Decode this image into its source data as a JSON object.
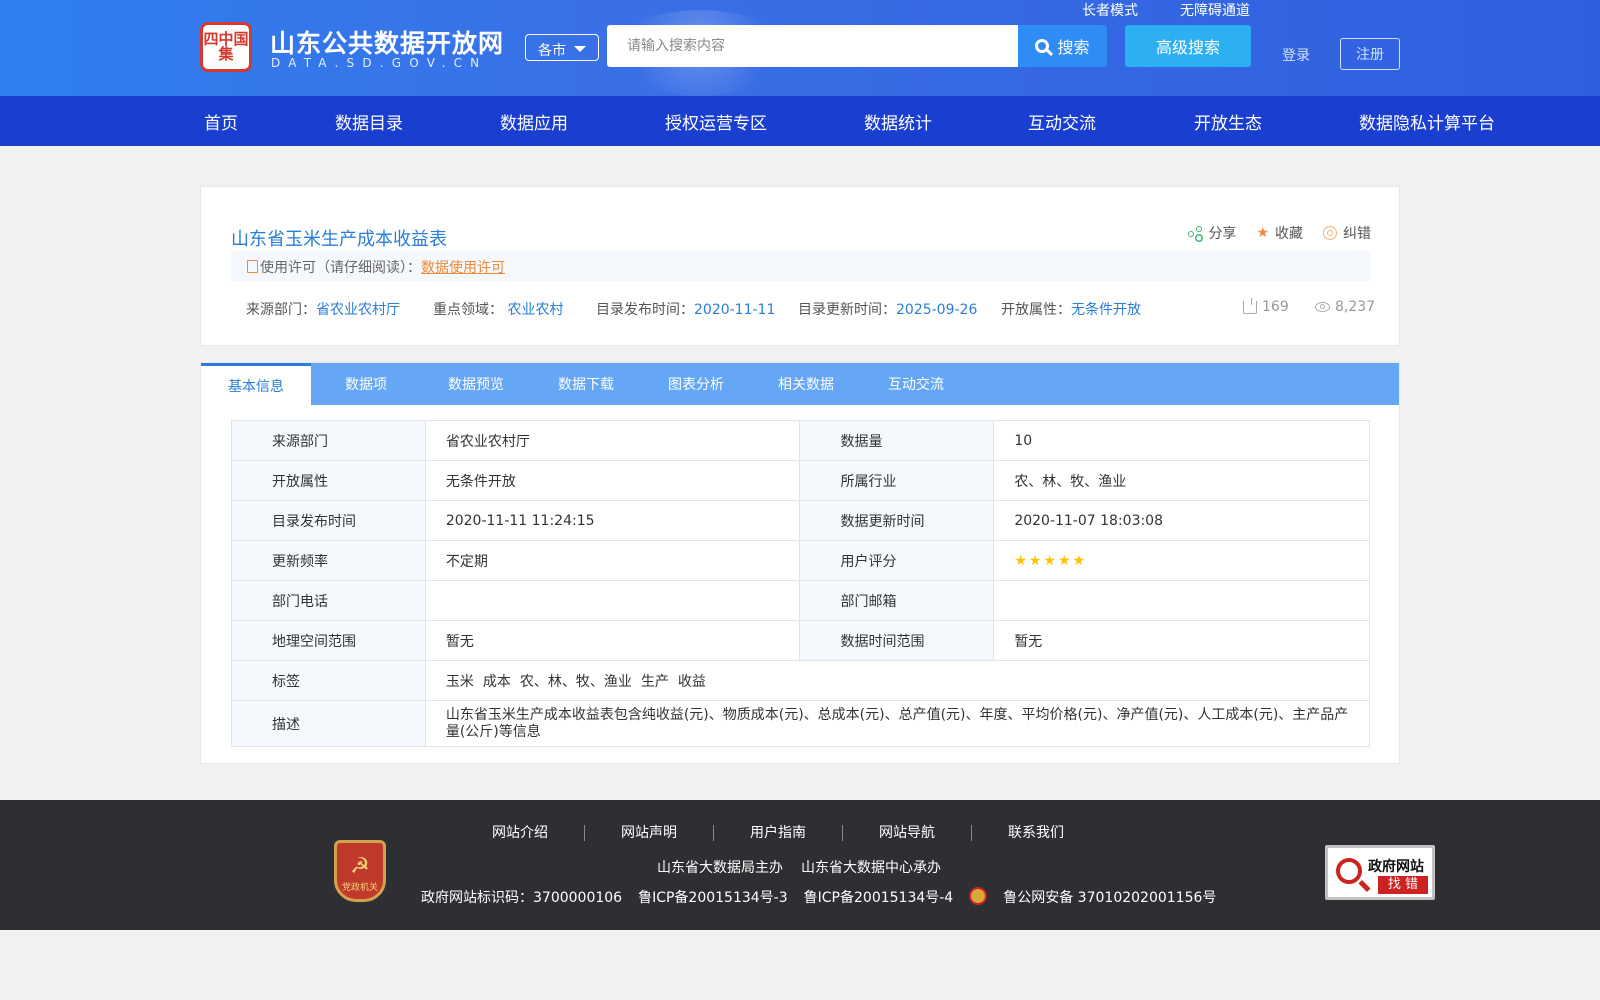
{
  "header": {
    "logo_seal": "四中国集",
    "site_name": "山东公共数据开放网",
    "site_domain": "DATA.SD.GOV.CN",
    "city_select": "各市",
    "search_placeholder": "请输入搜索内容",
    "search_button": "搜索",
    "advanced_search": "高级搜索",
    "elder_mode": "长者模式",
    "accessibility": "无障碍通道",
    "login": "登录",
    "register": "注册"
  },
  "nav": {
    "items": [
      "首页",
      "数据目录",
      "数据应用",
      "授权运营专区",
      "数据统计",
      "互动交流",
      "开放生态",
      "数据隐私计算平台"
    ]
  },
  "dataset": {
    "title": "山东省玉米生产成本收益表",
    "actions": {
      "share": "分享",
      "favorite": "收藏",
      "report_error": "纠错"
    },
    "license_label": "使用许可（请仔细阅读）：",
    "license_link": "数据使用许可",
    "source_dept_label": "来源部门：",
    "source_dept": "省农业农村厅",
    "domain_label": "重点领域：",
    "domain": "农业农村",
    "publish_label": "目录发布时间：",
    "publish_date": "2020-11-11",
    "update_label": "目录更新时间：",
    "update_date": "2025-09-26",
    "open_attr_label": "开放属性：",
    "open_attr": "无条件开放",
    "downloads": "169",
    "views": "8,237"
  },
  "tabs": [
    "基本信息",
    "数据项",
    "数据预览",
    "数据下载",
    "图表分析",
    "相关数据",
    "互动交流"
  ],
  "info": {
    "rows": [
      {
        "k1": "来源部门",
        "v1": "省农业农村厅",
        "k2": "数据量",
        "v2": "10"
      },
      {
        "k1": "开放属性",
        "v1": "无条件开放",
        "k2": "所属行业",
        "v2": "农、林、牧、渔业"
      },
      {
        "k1": "目录发布时间",
        "v1": "2020-11-11 11:24:15",
        "k2": "数据更新时间",
        "v2": "2020-11-07 18:03:08"
      },
      {
        "k1": "更新频率",
        "v1": "不定期",
        "k2": "用户评分",
        "v2": ""
      },
      {
        "k1": "部门电话",
        "v1": "",
        "k2": "部门邮箱",
        "v2": ""
      },
      {
        "k1": "地理空间范围",
        "v1": "暂无",
        "k2": "数据时间范围",
        "v2": "暂无"
      }
    ],
    "rating": 5,
    "tags_label": "标签",
    "tags": [
      "玉米",
      "成本",
      "农、林、牧、渔业",
      "生产",
      "收益"
    ],
    "desc_label": "描述",
    "description": "山东省玉米生产成本收益表包含纯收益(元)、物质成本(元)、总成本(元)、总产值(元)、年度、平均价格(元)、净产值(元)、人工成本(元)、主产品产量(公斤)等信息"
  },
  "footer": {
    "links": [
      "网站介绍",
      "网站声明",
      "用户指南",
      "网站导航",
      "联系我们"
    ],
    "sponsor": "山东省大数据局主办",
    "organizer": "山东省大数据中心承办",
    "site_id": "政府网站标识码：3700000106",
    "icp1": "鲁ICP备20015134号-3",
    "icp2": "鲁ICP备20015134号-4",
    "police": "鲁公网安备 37010202001156号",
    "party_badge": "党政机关",
    "gov_finder_title": "政府网站",
    "gov_finder_sub": "找 错"
  },
  "colors": {
    "header_blue": "#2f6fe6",
    "nav_blue": "#1a3fd0",
    "link_blue": "#2a7ed9",
    "accent_orange": "#f08a3a",
    "footer_bg": "#2e2f33"
  }
}
